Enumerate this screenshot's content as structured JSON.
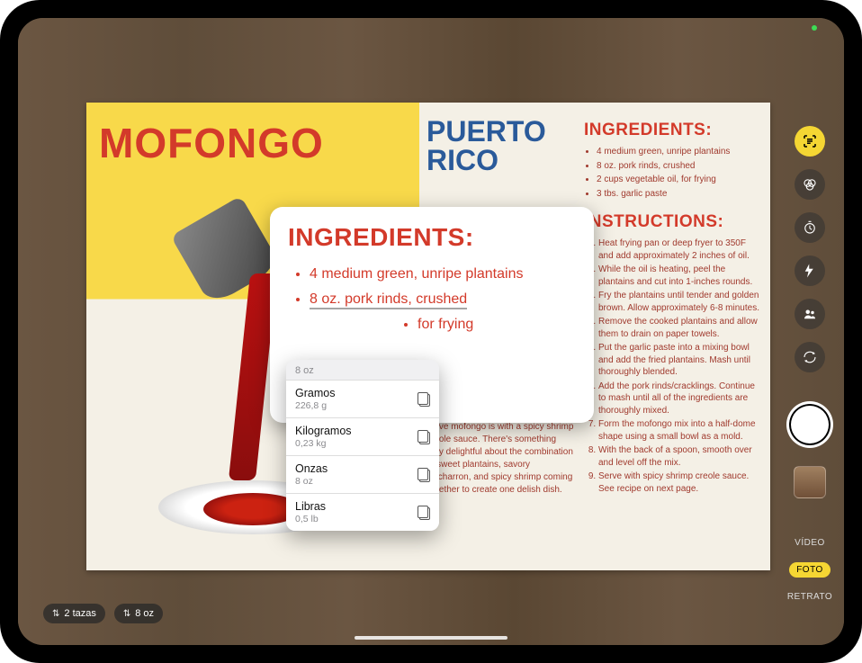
{
  "recipe": {
    "title": "MOFONGO",
    "region": "PUERTO RICO",
    "ingredients_heading": "INGREDIENTS:",
    "instructions_heading": "INSTRUCTIONS:",
    "ingredients": [
      "4 medium green, unripe plantains",
      "8 oz. pork rinds, crushed",
      "2 cups vegetable oil, for frying",
      "3 tbs. garlic paste"
    ],
    "blurb": "One of the most popular ways to serve mofongo is with a spicy shrimp creole sauce. There's something truly delightful about the combination of sweet plantains, savory chicharron, and spicy shrimp coming together to create one delish dish.",
    "instructions": [
      "Heat frying pan or deep fryer to 350F and add approximately 2 inches of oil.",
      "While the oil is heating, peel the plantains and cut into 1-inches rounds.",
      "Fry the plantains until tender and golden brown. Allow approximately 6-8 minutes.",
      "Remove the cooked plantains and allow them to drain on paper towels.",
      "Put the garlic paste into a mixing bowl and add the fried plantains. Mash until thoroughly blended.",
      "Add the pork rinds/cracklings. Continue to mash until all of the ingredients are thoroughly mixed.",
      "Form the mofongo mix into a half-dome shape using a small bowl as a mold.",
      "With the back of a spoon, smooth over and level off the mix.",
      "Serve with spicy shrimp creole sauce. See recipe on next page."
    ]
  },
  "overlay": {
    "heading": "INGREDIENTS:",
    "items": [
      {
        "text": "4 medium green, unripe plantains",
        "selected": false
      },
      {
        "text": "8 oz. pork rinds, crushed",
        "selected": true
      },
      {
        "text": "for frying",
        "selected": false
      }
    ]
  },
  "unit_popover": {
    "header": "8 oz",
    "rows": [
      {
        "name": "Gramos",
        "value": "226,8 g"
      },
      {
        "name": "Kilogramos",
        "value": "0,23 kg"
      },
      {
        "name": "Onzas",
        "value": "8 oz"
      },
      {
        "name": "Libras",
        "value": "0,5 lb"
      }
    ]
  },
  "camera": {
    "modes": {
      "video": "VÍDEO",
      "photo": "FOTO",
      "portrait": "RETRATO"
    },
    "icons": {
      "live_text": "live-text-icon",
      "filters": "filters-icon",
      "timer": "timer-icon",
      "flash": "flash-icon",
      "shared": "shared-library-icon",
      "flip": "camera-flip-icon"
    }
  },
  "bottom": {
    "pill1": "2 tazas",
    "pill2": "8 oz"
  }
}
